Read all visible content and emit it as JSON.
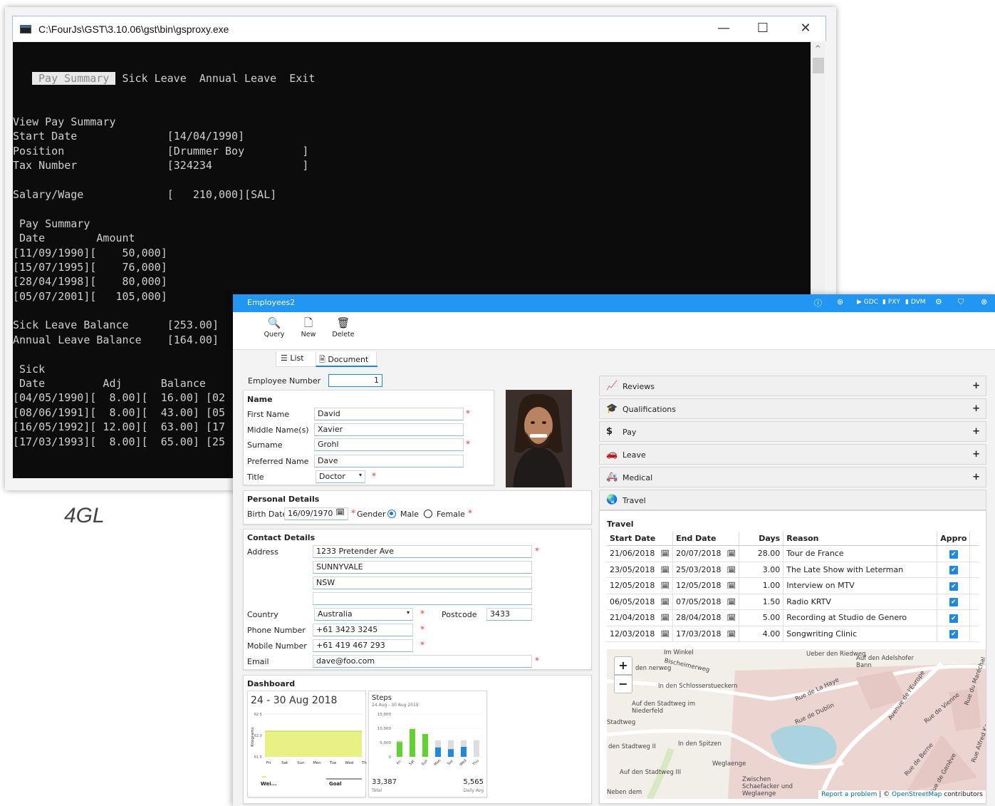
{
  "console": {
    "title": "C:\\FourJs\\GST\\3.10.06\\gst\\bin\\gsproxy.exe",
    "controls": {
      "minimize": "—",
      "maximize": "☐",
      "close": "✕"
    },
    "menu": [
      "Pay Summary",
      "Sick Leave",
      "Annual Leave",
      "Exit"
    ],
    "lines": [
      "View Pay Summary",
      "Start Date              [14/04/1990]",
      "Position                [Drummer Boy         ]",
      "Tax Number              [324234              ]",
      "",
      "Salary/Wage             [   210,000][SAL]",
      "",
      " Pay Summary",
      " Date        Amount",
      "[11/09/1990][    50,000]",
      "[15/07/1995][    76,000]",
      "[28/04/1998][    80,000]",
      "[05/07/2001][   105,000]",
      "",
      "Sick Leave Balance      [253.00]",
      "Annual Leave Balance    [164.00]",
      "",
      " Sick                              An",
      " Date         Adj      Balance     Da",
      "[04/05/1990][  8.00][  16.00] [02",
      "[08/06/1991][  8.00][  43.00] [05",
      "[16/05/1992][ 12.00][  63.00] [17",
      "[17/03/1993][  8.00][  65.00] [25"
    ]
  },
  "caption": "4GL",
  "gbc": {
    "title": "Employees2",
    "top_icons": [
      "ⓘ",
      "⊛",
      "▶ GDC",
      "PXY",
      "DVM",
      "⚙",
      "⛉",
      "⊗"
    ],
    "toolbar": {
      "query": "Query",
      "new": "New",
      "delete": "Delete"
    },
    "folder_tabs": {
      "list": "List",
      "document": "Document"
    },
    "employee_number_label": "Employee Number",
    "employee_number": "1",
    "name_group": "Name",
    "first_name_label": "First Name",
    "first_name": "David",
    "middle_name_label": "Middle Name(s)",
    "middle_name": "Xavier",
    "surname_label": "Surname",
    "surname": "Grohl",
    "preferred_name_label": "Preferred Name",
    "preferred_name": "Dave",
    "title_label": "Title",
    "title_value": "Doctor",
    "personal_group": "Personal Details",
    "birth_date_label": "Birth Date",
    "birth_date": "16/09/1970",
    "gender_label": "Gender",
    "gender_male": "Male",
    "gender_female": "Female",
    "contact_group": "Contact Details",
    "address_label": "Address",
    "address": [
      "1233  Pretender Ave",
      "SUNNYVALE",
      "NSW",
      ""
    ],
    "country_label": "Country",
    "country": "Australia",
    "postcode_label": "Postcode",
    "postcode": "3433",
    "phone_label": "Phone Number",
    "phone": "+61 3423 3245",
    "mobile_label": "Mobile Number",
    "mobile": "+61 419 467 293",
    "email_label": "Email",
    "email": "dave@foo.com",
    "dashboard_group": "Dashboard",
    "weight_card": {
      "title": "24 - 30 Aug 2018",
      "ylabel": "Kilograms",
      "legend_a": "Wei...",
      "legend_b": "Goal"
    },
    "steps_card": {
      "title": "Steps",
      "subtitle": "24 Aug - 30 Aug 2018",
      "total": "33,387",
      "total_label": "Total",
      "avg": "5,565",
      "avg_label": "Daily Avg"
    },
    "accordion": [
      {
        "icon": "📈",
        "label": "Reviews"
      },
      {
        "icon": "🎓",
        "label": "Qualifications"
      },
      {
        "icon": "$",
        "label": "Pay"
      },
      {
        "icon": "🚗",
        "label": "Leave"
      },
      {
        "icon": "🚑",
        "label": "Medical"
      },
      {
        "icon": "🌏",
        "label": "Travel"
      }
    ],
    "travel": {
      "title": "Travel",
      "columns": [
        "Start Date",
        "End Date",
        "Days",
        "Reason",
        "Appro"
      ],
      "rows": [
        {
          "start": "21/06/2018",
          "end": "20/07/2018",
          "days": "28.00",
          "reason": "Tour de France"
        },
        {
          "start": "23/05/2018",
          "end": "25/03/2018",
          "days": "3.00",
          "reason": "The Late Show with Leterman"
        },
        {
          "start": "12/05/2018",
          "end": "12/05/2018",
          "days": "1.00",
          "reason": "Interview on MTV"
        },
        {
          "start": "06/05/2018",
          "end": "07/05/2018",
          "days": "1.50",
          "reason": "Radio KRTV"
        },
        {
          "start": "21/04/2018",
          "end": "28/04/2018",
          "days": "5.00",
          "reason": "Recording at Studio de Genero"
        },
        {
          "start": "12/03/2018",
          "end": "17/03/2018",
          "days": "4.00",
          "reason": "Songwriting Clinic"
        }
      ]
    },
    "map": {
      "zoom_in": "+",
      "zoom_out": "−",
      "labels": [
        "Im Winkel",
        "Ueber den Riedweg",
        "Auf den Adelshofer Bann",
        "den nerweg",
        "Bischeimerweg",
        "In den Schlosserstueckern",
        "Auf den Stadtweg im Niederfeld",
        "Stadtweg",
        "den Stadtweg II",
        "In den Spitzen",
        "Weglaenge",
        "Auf den Stadtweg III",
        "Zwischen Schaefacker und Weglaenge",
        "Neben dem",
        "Rue de La Haye",
        "Rue de Dublin",
        "Rue de Vienne",
        "Avenue de l'Europe",
        "Rue de Berne",
        "Rue de Genève",
        "Rue du Maréchal",
        "Rue Alfred Kastler"
      ],
      "attribution": {
        "report": "Report a problem",
        "sep": " | © ",
        "osm": "OpenStreetMap",
        "tail": " contributors"
      }
    }
  },
  "chart_data": [
    {
      "type": "line",
      "title": "24 - 30 Aug 2018",
      "ylabel": "Kilograms",
      "categories": [
        "Fri",
        "Sat",
        "Sun",
        "Mon",
        "Tue",
        "Wed",
        "Thu"
      ],
      "yticks": [
        "62.5",
        "62.0",
        "61.5"
      ],
      "ylim": [
        61.5,
        62.5
      ],
      "series": [
        {
          "name": "Wei...",
          "values": [
            62.1,
            62.1,
            62.1,
            62.1,
            62.1,
            62.1,
            62.1
          ]
        },
        {
          "name": "Goal",
          "values": [
            62.1,
            62.1,
            62.1,
            62.1,
            62.1,
            62.1,
            62.1
          ]
        }
      ]
    },
    {
      "type": "bar",
      "title": "Steps",
      "subtitle": "24 Aug - 30 Aug 2018",
      "categories": [
        "Fri",
        "Sat",
        "Sun",
        "Mon",
        "Tue",
        "Wed",
        "Thu"
      ],
      "yticks": [
        "15,000",
        "10,000",
        "5,000",
        "0"
      ],
      "ylim": [
        0,
        15000
      ],
      "colors": {
        "green": "#5ed42c",
        "blue": "#1e88e5",
        "goal": "#dddddd"
      },
      "values": [
        5200,
        9800,
        8000,
        3300,
        2700,
        3500,
        0
      ],
      "value_colors": [
        "green",
        "green",
        "green",
        "blue",
        "blue",
        "blue",
        "blue"
      ],
      "goal": 5800
    }
  ]
}
